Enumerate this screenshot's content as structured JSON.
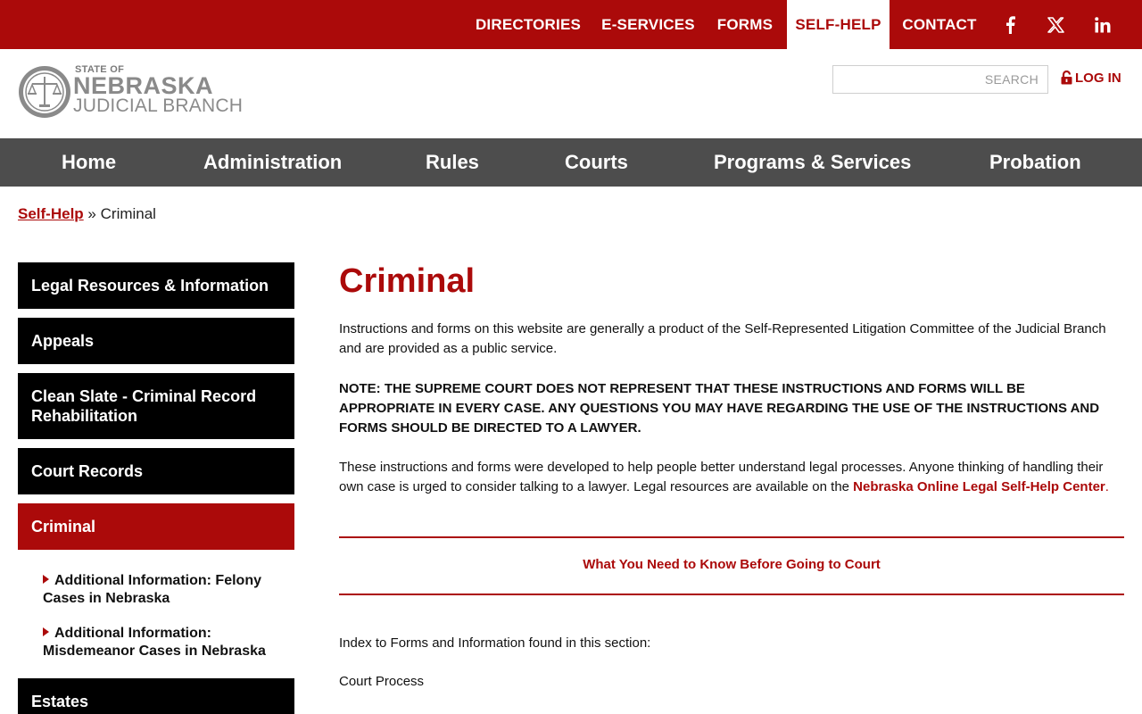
{
  "topbar": {
    "links": [
      "DIRECTORIES",
      "E-SERVICES",
      "FORMS",
      "SELF-HELP",
      "CONTACT"
    ],
    "active": "SELF-HELP",
    "social_icons": [
      "facebook-icon",
      "x-icon",
      "linkedin-icon"
    ]
  },
  "header": {
    "logo": {
      "line1": "STATE OF",
      "line2": "NEBRASKA",
      "line3": "JUDICIAL BRANCH"
    },
    "search_placeholder": "SEARCH",
    "login_label": "LOG IN"
  },
  "mainnav": [
    "Home",
    "Administration",
    "Rules",
    "Courts",
    "Programs & Services",
    "Probation"
  ],
  "breadcrumb": {
    "parent": "Self-Help",
    "separator": "»",
    "current": "Criminal"
  },
  "sidebar": {
    "items": [
      "Legal Resources & Information",
      "Appeals",
      "Clean Slate - Criminal Record Rehabilitation",
      "Court Records",
      "Criminal",
      "Estates"
    ],
    "active": "Criminal",
    "subitems": [
      "Additional Information: Felony Cases in Nebraska",
      "Additional Information: Misdemeanor Cases in Nebraska"
    ]
  },
  "content": {
    "title": "Criminal",
    "intro": "Instructions and forms on this website are generally a product of the Self-Represented Litigation Committee of the Judicial Branch and are provided as a public service.",
    "note": "NOTE: THE SUPREME COURT DOES NOT REPRESENT THAT THESE INSTRUCTIONS AND FORMS WILL BE APPROPRIATE IN EVERY CASE. ANY QUESTIONS YOU MAY HAVE REGARDING THE USE OF THE INSTRUCTIONS AND FORMS SHOULD BE DIRECTED TO A LAWYER.",
    "help_text": "These instructions and forms were developed to help people better understand legal processes. Anyone thinking of handling their own case is urged to consider talking to a lawyer. Legal resources are available on the",
    "help_link": "Nebraska Online Legal Self-Help Center",
    "help_end": ".",
    "know_before_link": "What You Need to Know Before Going to Court",
    "index_text": "Index to Forms and Information found in this section:",
    "section_heading": "Court Process"
  },
  "colors": {
    "brand_red": "#ab0a0a",
    "nav_gray": "#4d4d4d",
    "black": "#000000"
  }
}
